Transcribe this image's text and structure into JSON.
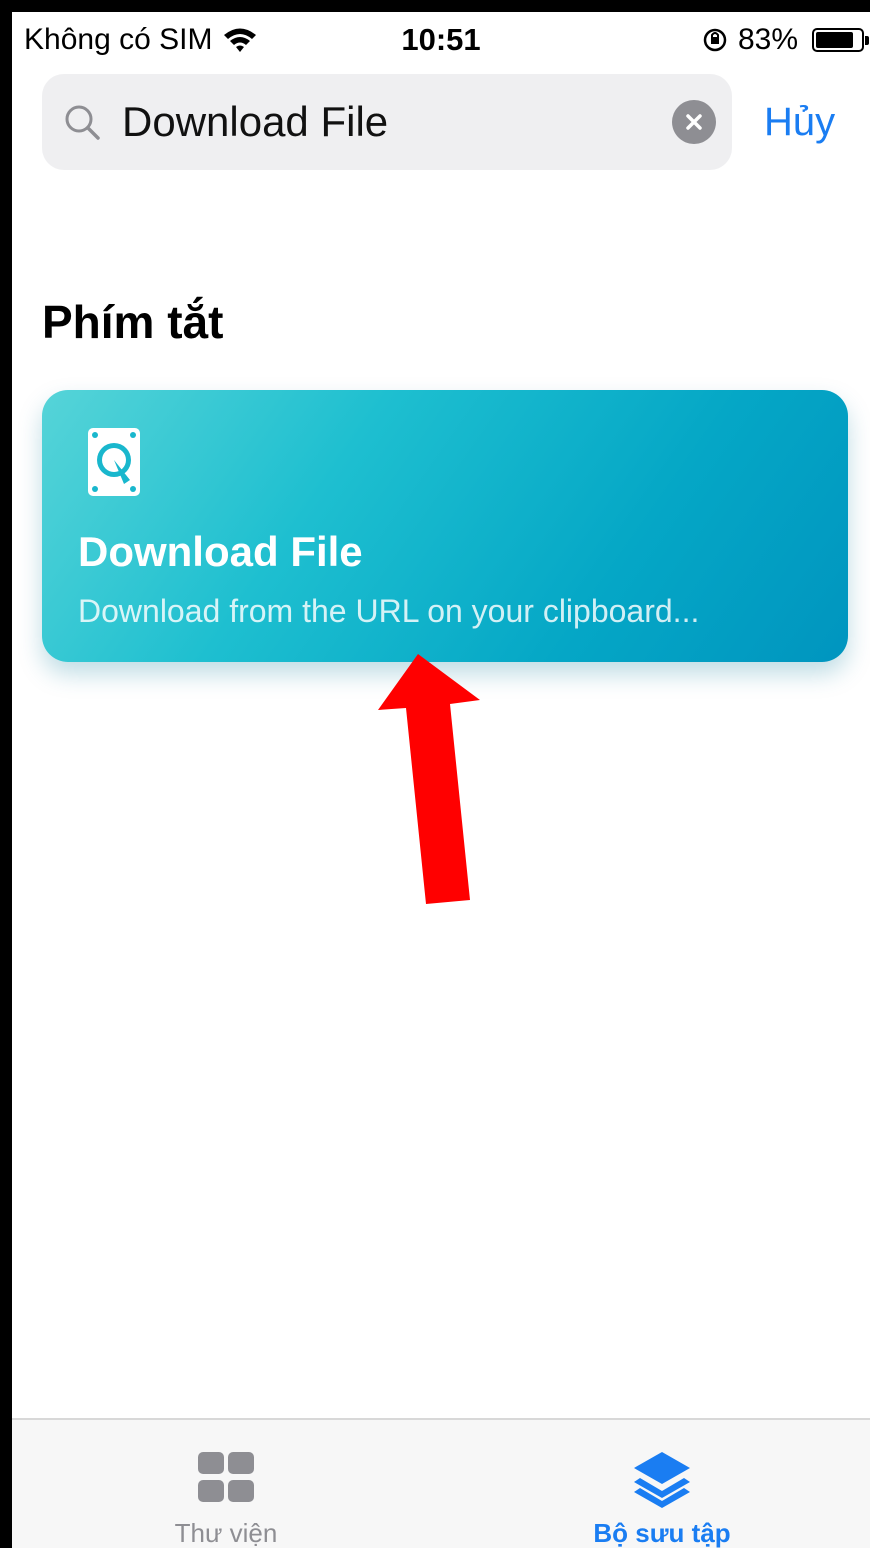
{
  "status_bar": {
    "carrier": "Không có SIM",
    "time": "10:51",
    "battery_percent": "83%",
    "battery_level": 0.83,
    "icons": [
      "wifi-icon",
      "orientation-lock-icon",
      "battery-icon"
    ]
  },
  "search": {
    "query": "Download File",
    "cancel_label": "Hủy",
    "icons": [
      "search-icon",
      "clear-icon"
    ]
  },
  "section": {
    "title": "Phím tắt"
  },
  "shortcut": {
    "title": "Download File",
    "subtitle": "Download from the URL on your clipboard...",
    "icon": "hard-drive-icon",
    "colors": {
      "gradient_start": "#56d4d8",
      "gradient_end": "#0095bf"
    }
  },
  "annotation": {
    "type": "arrow",
    "color": "#ff0000"
  },
  "tab_bar": {
    "tabs": [
      {
        "label": "Thư viện",
        "icon": "library-grid-icon",
        "selected": false
      },
      {
        "label": "Bộ sưu tập",
        "icon": "gallery-layers-icon",
        "selected": true
      }
    ],
    "accent": "#1a7df2",
    "inactive": "#8e8e93"
  }
}
